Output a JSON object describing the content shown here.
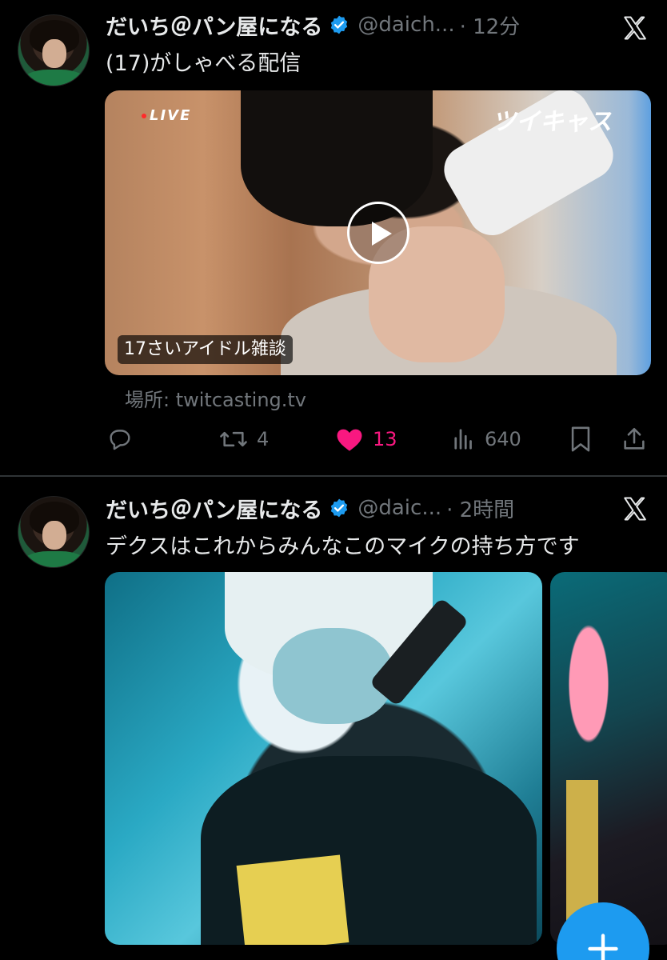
{
  "tweets": [
    {
      "author_name": "だいち＠パン屋になる",
      "handle": "@daich...",
      "time": "· 12分",
      "text": "(17)がしゃべる配信",
      "card": {
        "live_label": "LIVE",
        "brand": "ツイキャス",
        "title": "17さいアイドル雑談"
      },
      "location": "場所: twitcasting.tv",
      "actions": {
        "replies": "",
        "retweets": "4",
        "likes": "13",
        "views": "640"
      }
    },
    {
      "author_name": "だいち＠パン屋になる",
      "handle": "@daic...",
      "time": "· 2時間",
      "text": "デクスはこれからみんなこのマイクの持ち方です"
    }
  ],
  "colors": {
    "background": "#000000",
    "text": "#e7e9ea",
    "muted": "#71767b",
    "like": "#f91880",
    "verified": "#1d9bf0",
    "fab": "#1d9bf0"
  },
  "icons": [
    "verified-badge-icon",
    "x-logo-icon",
    "play-icon",
    "reply-icon",
    "retweet-icon",
    "heart-icon",
    "views-icon",
    "bookmark-icon",
    "share-icon",
    "plus-icon"
  ]
}
